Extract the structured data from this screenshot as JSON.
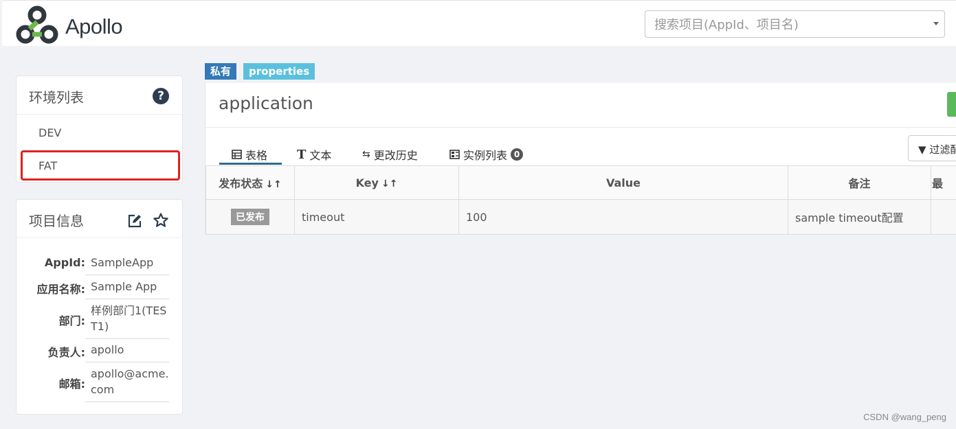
{
  "header": {
    "brand": "Apollo",
    "search_placeholder": "搜索项目(AppId、项目名)"
  },
  "env_panel": {
    "title": "环境列表",
    "items": [
      {
        "label": "DEV"
      },
      {
        "label": "FAT",
        "highlighted": true
      }
    ]
  },
  "project_info": {
    "title": "项目信息",
    "rows": [
      {
        "label": "AppId:",
        "value": "SampleApp"
      },
      {
        "label": "应用名称:",
        "value": "Sample App"
      },
      {
        "label": "部门:",
        "value": "样例部门1(TEST1)"
      },
      {
        "label": "负责人:",
        "value": "apollo"
      },
      {
        "label": "邮箱:",
        "value": "apollo@acme.com"
      }
    ]
  },
  "namespace": {
    "tags": [
      "私有",
      "properties"
    ],
    "name": "application",
    "tabs": [
      {
        "label": "表格",
        "icon": "table-icon",
        "active": true
      },
      {
        "label": "文本",
        "icon": "text-icon"
      },
      {
        "label": "更改历史",
        "icon": "history-icon"
      },
      {
        "label": "实例列表",
        "icon": "instance-icon",
        "badge": "0"
      }
    ],
    "filter_label": "过滤配置",
    "table": {
      "columns": [
        "发布状态",
        "Key",
        "Value",
        "备注",
        "最"
      ],
      "rows": [
        {
          "status": "已发布",
          "key": "timeout",
          "value": "100",
          "comment": "sample timeout配置",
          "last": ""
        }
      ]
    }
  },
  "watermark": "CSDN @wang_peng",
  "colors": {
    "tag_private": "#337ab7",
    "tag_properties": "#5bc0de",
    "highlight_border": "#e02020",
    "published_badge": "#999999"
  }
}
